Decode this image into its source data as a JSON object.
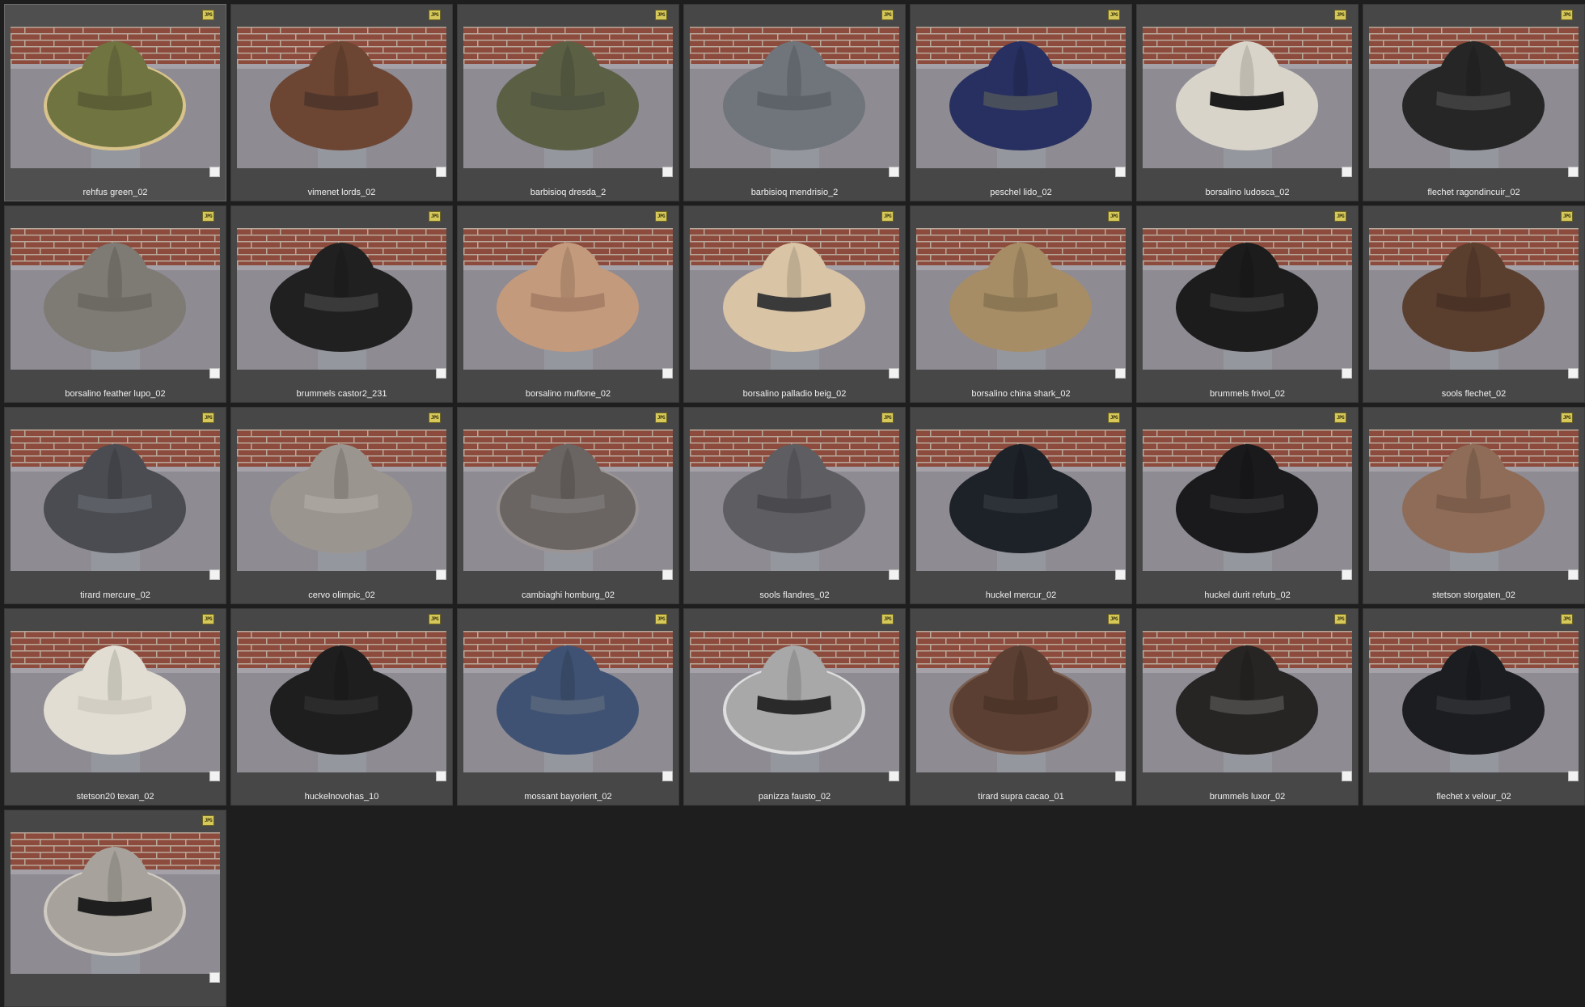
{
  "badge_label": "JPG",
  "items": [
    {
      "label": "rehfus green_02",
      "hat": "#6f7441",
      "band": "#5c5e36",
      "trim": "#d8c38a",
      "selected": true
    },
    {
      "label": "vimenet lords_02",
      "hat": "#6c4633",
      "band": "#51372b",
      "trim": ""
    },
    {
      "label": "barbisioq dresda_2",
      "hat": "#5b6045",
      "band": "#4e5440",
      "trim": ""
    },
    {
      "label": "barbisioq mendrisio_2",
      "hat": "#6f757b",
      "band": "#5d6368",
      "trim": ""
    },
    {
      "label": "peschel lido_02",
      "hat": "#273060",
      "band": "#4a4f5c",
      "trim": ""
    },
    {
      "label": "borsalino ludosca_02",
      "hat": "#d9d4c9",
      "band": "#1e1e1e",
      "trim": ""
    },
    {
      "label": "flechet ragondincuir_02",
      "hat": "#262626",
      "band": "#3f3f3f",
      "trim": ""
    },
    {
      "label": "borsalino feather lupo_02",
      "hat": "#7e7a74",
      "band": "#6d6963",
      "trim": ""
    },
    {
      "label": "brummels castor2_231",
      "hat": "#202020",
      "band": "#3a3a3a",
      "trim": ""
    },
    {
      "label": "borsalino muflone_02",
      "hat": "#c49a7c",
      "band": "#a88067",
      "trim": ""
    },
    {
      "label": "borsalino palladio beig_02",
      "hat": "#d9c4a5",
      "band": "#3a3a3a",
      "trim": ""
    },
    {
      "label": "borsalino china shark_02",
      "hat": "#a68d66",
      "band": "#8c7755",
      "trim": ""
    },
    {
      "label": "brummels frivol_02",
      "hat": "#1c1c1c",
      "band": "#303030",
      "trim": ""
    },
    {
      "label": "sools flechet_02",
      "hat": "#5a3e2e",
      "band": "#4a3226",
      "trim": ""
    },
    {
      "label": "tirard mercure_02",
      "hat": "#4a4c52",
      "band": "#5c5f66",
      "trim": ""
    },
    {
      "label": "cervo olimpic_02",
      "hat": "#9b958f",
      "band": "#a9a49d",
      "trim": ""
    },
    {
      "label": "cambiaghi homburg_02",
      "hat": "#6a6462",
      "band": "#7a7575",
      "trim": "#9a9494"
    },
    {
      "label": "sools flandres_02",
      "hat": "#5e5e62",
      "band": "#4a4a4e",
      "trim": ""
    },
    {
      "label": "huckel mercur_02",
      "hat": "#1d2228",
      "band": "#2c3238",
      "trim": ""
    },
    {
      "label": "huckel durit refurb_02",
      "hat": "#1a1a1c",
      "band": "#2a2a2c",
      "trim": ""
    },
    {
      "label": "stetson storgaten_02",
      "hat": "#8e6c57",
      "band": "#7c5c4a",
      "trim": ""
    },
    {
      "label": "stetson20 texan_02",
      "hat": "#e1ddd2",
      "band": "#d3cec3",
      "trim": ""
    },
    {
      "label": "huckelnovohas_10",
      "hat": "#1e1e1e",
      "band": "#2b2b2b",
      "trim": ""
    },
    {
      "label": "mossant bayorient_02",
      "hat": "#3f5273",
      "band": "#55647a",
      "trim": ""
    },
    {
      "label": "panizza fausto_02",
      "hat": "#a8a8a8",
      "band": "#2a2a2a",
      "trim": "#dedede"
    },
    {
      "label": "tirard supra cacao_01",
      "hat": "#5b3f32",
      "band": "#4d3529",
      "trim": "#7a5e50"
    },
    {
      "label": "brummels luxor_02",
      "hat": "#272524",
      "band": "#4a4847",
      "trim": ""
    },
    {
      "label": "flechet x velour_02",
      "hat": "#1c1d20",
      "band": "#2d2e31",
      "trim": ""
    },
    {
      "label": "",
      "hat": "#a7a39c",
      "band": "#1f1f1f",
      "trim": "#cfcac2"
    }
  ]
}
